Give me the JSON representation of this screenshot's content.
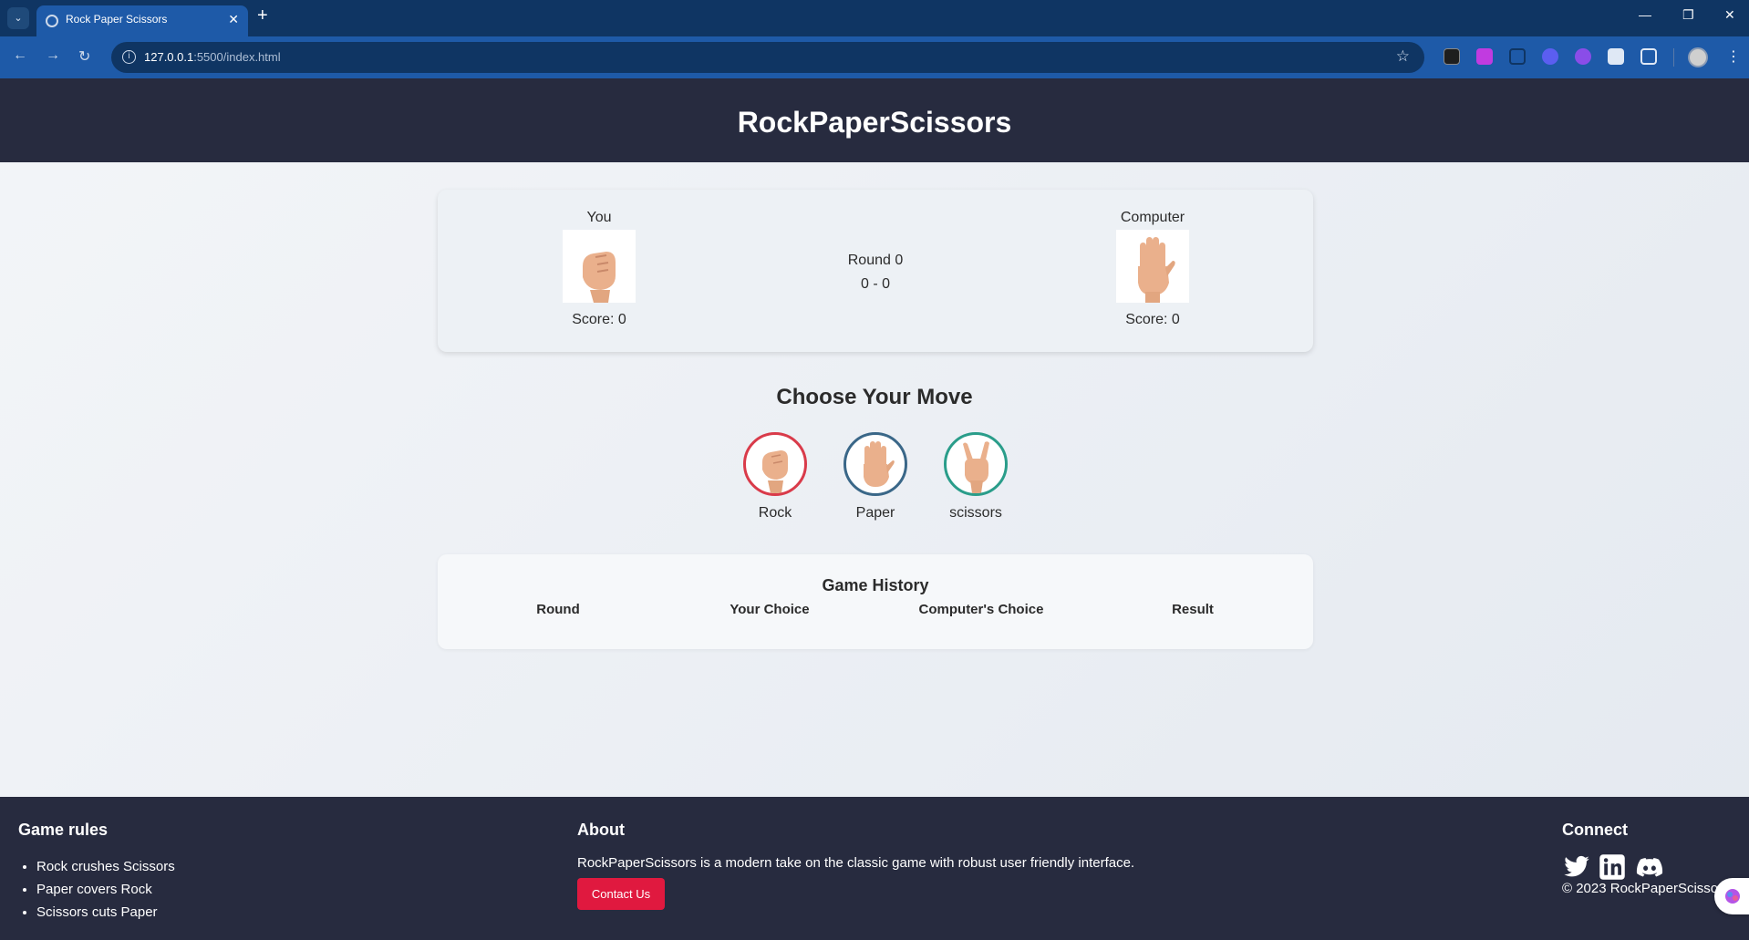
{
  "browser": {
    "tab_title": "Rock Paper Scissors",
    "tab_close": "✕",
    "new_tab": "+",
    "url_host": "127.0.0.1",
    "url_rest": ":5500/index.html",
    "window_controls": [
      "—",
      "❐",
      "✕"
    ]
  },
  "header": {
    "title": "RockPaperScissors"
  },
  "scoreboard": {
    "you": {
      "label": "You",
      "score": "Score: 0",
      "hand_icon": "rock-hand"
    },
    "computer": {
      "label": "Computer",
      "score": "Score: 0",
      "hand_icon": "paper-hand"
    },
    "round": "Round 0",
    "tally": "0 - 0"
  },
  "moves": {
    "title": "Choose Your Move",
    "items": [
      {
        "label": "Rock",
        "color": "#d93b4a",
        "icon": "rock-hand"
      },
      {
        "label": "Paper",
        "color": "#3a6788",
        "icon": "paper-hand"
      },
      {
        "label": "scissors",
        "color": "#2a9d8a",
        "icon": "scissors-hand"
      }
    ]
  },
  "history": {
    "title": "Game History",
    "columns": [
      "Round",
      "Your Choice",
      "Computer's Choice",
      "Result"
    ]
  },
  "footer": {
    "rules_title": "Game rules",
    "rules": [
      "Rock crushes Scissors",
      "Paper covers Rock",
      "Scissors cuts Paper"
    ],
    "about_title": "About",
    "about_text": "RockPaperScissors is a modern take on the classic game with robust user friendly interface.",
    "contact_button": "Contact Us",
    "connect_title": "Connect",
    "social": [
      "twitter-icon",
      "linkedin-icon",
      "discord-icon"
    ],
    "copyright": "© 2023 RockPaperScissors"
  },
  "colors": {
    "header_bg": "#272b3f",
    "accent": "#e0193f",
    "chrome": "#1e5aa8"
  }
}
